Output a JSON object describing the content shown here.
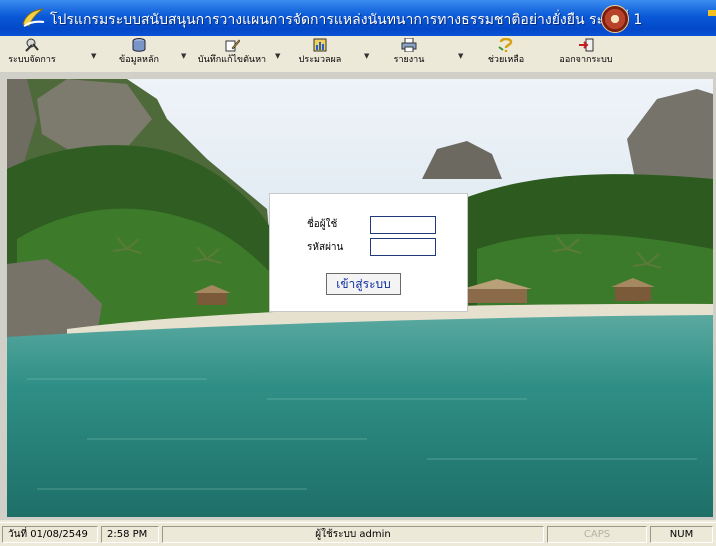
{
  "window": {
    "title": "โปรแกรมระบบสนับสนุนการวางแผนการจัดการแหล่งนันทนาการทางธรรมชาติอย่างยั่งยืน ระยะที่ 1"
  },
  "menu": {
    "items": [
      {
        "label": "ระบบจัดการ",
        "icon": "admin-tools-icon"
      },
      {
        "label": "ข้อมูลหลัก",
        "icon": "database-icon"
      },
      {
        "label": "บันทึกแก้ไขตันหา",
        "icon": "edit-record-icon"
      },
      {
        "label": "ประมวลผล",
        "icon": "process-icon"
      },
      {
        "label": "รายงาน",
        "icon": "printer-icon"
      },
      {
        "label": "ช่วยเหลือ",
        "icon": "help-icon"
      },
      {
        "label": "ออกจากระบบ",
        "icon": "exit-icon"
      }
    ]
  },
  "login": {
    "username_label": "ชื่อผู้ใช้",
    "password_label": "รหัสผ่าน",
    "username_value": "",
    "password_value": "",
    "submit_label": "เข้าสู่ระบบ"
  },
  "statusbar": {
    "date": "วันที่ 01/08/2549",
    "time": "2:58 PM",
    "user": "ผู้ใช้ระบบ admin",
    "caps": "CAPS",
    "num": "NUM"
  },
  "colors": {
    "titlebar": "#0a59d8",
    "chrome": "#ece9d8",
    "sea": "#2f8f86",
    "sky": "#cfe0ee",
    "login_button_text": "#0c2ca0"
  }
}
